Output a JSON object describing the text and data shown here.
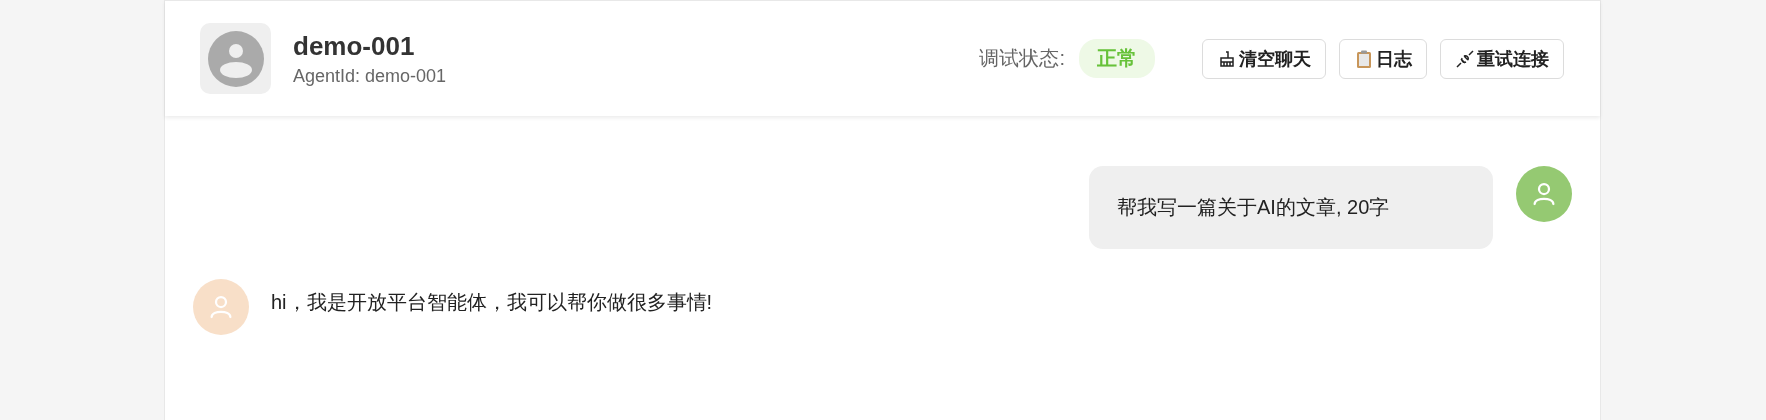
{
  "header": {
    "title": "demo-001",
    "subtitle": "AgentId: demo-001",
    "status_label": "调试状态:",
    "status": "正常",
    "buttons": [
      {
        "kind": "clear",
        "label": "清空聊天"
      },
      {
        "kind": "log",
        "label": "日志"
      },
      {
        "kind": "reconnect",
        "label": "重试连接"
      }
    ]
  },
  "messages": [
    {
      "kind": "user",
      "text": "帮我写一篇关于AI的文章, 20字"
    },
    {
      "kind": "bot",
      "text": "hi，我是开放平台智能体，我可以帮你做很多事情!"
    }
  ]
}
